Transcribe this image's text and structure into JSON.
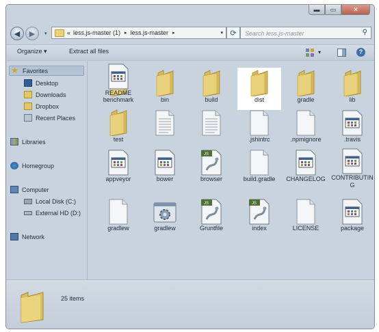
{
  "window": {
    "minimize": "▬",
    "maximize": "▭",
    "close": "✕"
  },
  "navigation": {
    "back_icon": "back-arrow",
    "forward_icon": "forward-arrow",
    "recent_icon": "▾",
    "path": [
      "less.js-master (1)",
      "less.js-master"
    ],
    "path_prefix": "«",
    "separator": "▸",
    "dropdown": "▾",
    "refresh": "⟳",
    "search_placeholder": "Search less.js-master"
  },
  "toolbar": {
    "organize": "Organize ▾",
    "extract": "Extract all files",
    "view_arrow": "▾",
    "help": "?"
  },
  "sidebar": {
    "favorites": {
      "label": "Favorites",
      "items": [
        "Desktop",
        "Downloads",
        "Dropbox",
        "Recent Places"
      ]
    },
    "libraries": "Libraries",
    "homegroup": "Homegroup",
    "computer": {
      "label": "Computer",
      "items": [
        "Local Disk (C:)",
        "External HD (D:)"
      ]
    },
    "network": "Network"
  },
  "files": [
    {
      "name": "benchmark",
      "type": "folder"
    },
    {
      "name": "bin",
      "type": "folder"
    },
    {
      "name": "build",
      "type": "folder"
    },
    {
      "name": "dist",
      "type": "folder",
      "selected": true
    },
    {
      "name": "gradle",
      "type": "folder"
    },
    {
      "name": "lib",
      "type": "folder"
    },
    {
      "name": "test",
      "type": "folder"
    },
    {
      "name": "",
      "type": "text"
    },
    {
      "name": "",
      "type": "text"
    },
    {
      "name": ".jshintrc",
      "type": "file"
    },
    {
      "name": ".npmignore",
      "type": "file"
    },
    {
      "name": ".travis",
      "type": "app"
    },
    {
      "name": "appveyor",
      "type": "app"
    },
    {
      "name": "bower",
      "type": "app"
    },
    {
      "name": "browser",
      "type": "js"
    },
    {
      "name": "build.gradle",
      "type": "file"
    },
    {
      "name": "CHANGELOG",
      "type": "app"
    },
    {
      "name": "CONTRIBUTING",
      "type": "app"
    },
    {
      "name": "gradlew",
      "type": "file"
    },
    {
      "name": "gradlew",
      "type": "gear"
    },
    {
      "name": "Gruntfile",
      "type": "js"
    },
    {
      "name": "index",
      "type": "js"
    },
    {
      "name": "LICENSE",
      "type": "file"
    },
    {
      "name": "package",
      "type": "app"
    },
    {
      "name": "README",
      "type": "app"
    }
  ],
  "file_badges": {
    "js": "JS"
  },
  "status": {
    "count": "25 items"
  }
}
